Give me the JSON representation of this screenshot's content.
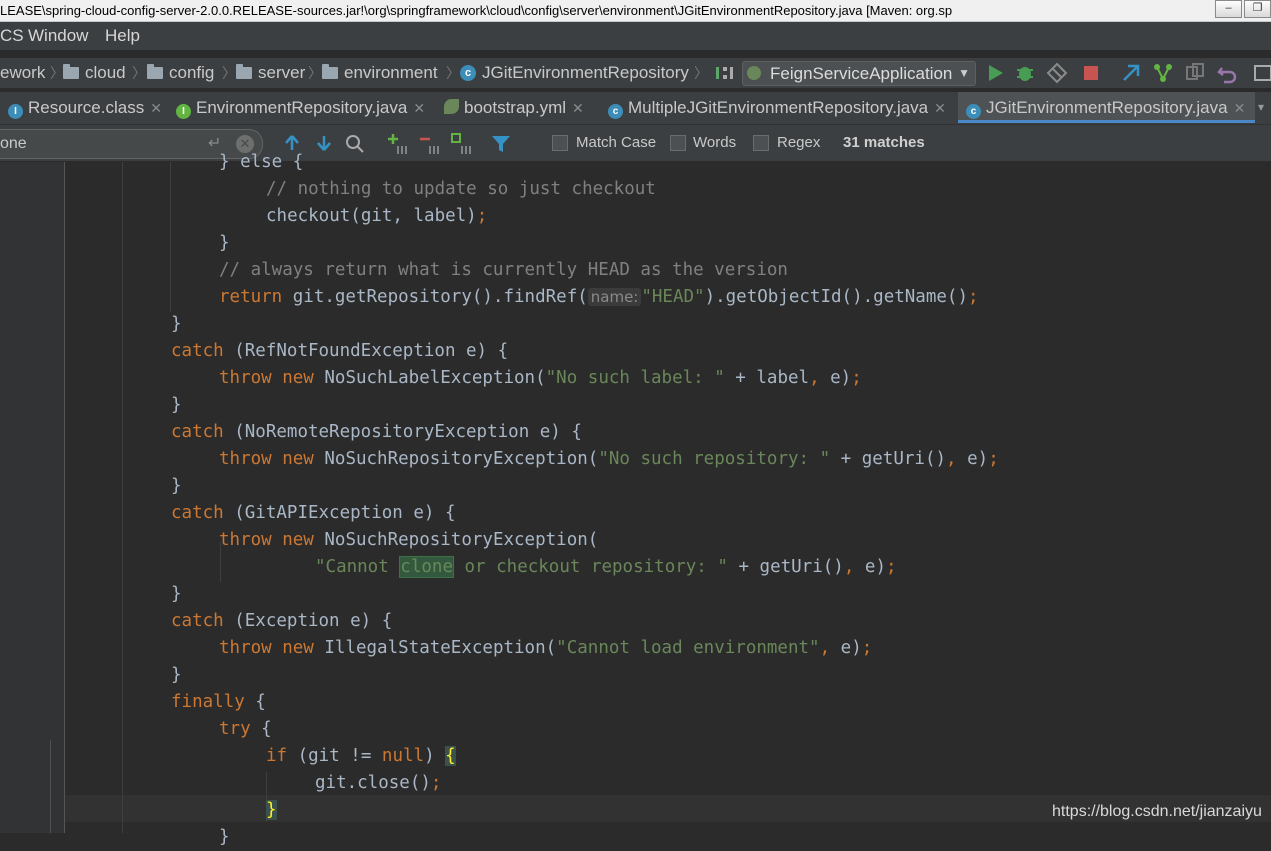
{
  "titlebar": {
    "title": "LEASE\\spring-cloud-config-server-2.0.0.RELEASE-sources.jar!\\org\\springframework\\cloud\\config\\server\\environment\\JGitEnvironmentRepository.java [Maven: org.sp"
  },
  "menu": {
    "vcs": "CS",
    "window": "Window",
    "help": "Help"
  },
  "breadcrumbs": [
    "ework",
    "cloud",
    "config",
    "server",
    "environment",
    "JGitEnvironmentRepository"
  ],
  "run_config": {
    "name": "FeignServiceApplication"
  },
  "tabs": [
    {
      "label": "Resource.class",
      "icon": "class-icon"
    },
    {
      "label": "EnvironmentRepository.java",
      "icon": "interface-icon"
    },
    {
      "label": "bootstrap.yml",
      "icon": "spring-leaf-icon"
    },
    {
      "label": "MultipleJGitEnvironmentRepository.java",
      "icon": "class-icon"
    },
    {
      "label": "JGitEnvironmentRepository.java",
      "icon": "class-icon",
      "active": true
    }
  ],
  "find": {
    "query": "one",
    "match_case": "Match Case",
    "words": "Words",
    "regex": "Regex",
    "matches": "31 matches"
  },
  "code": {
    "l0": "} else {",
    "l1": "// nothing to update so just checkout",
    "l2a": "checkout(git, label)",
    "l4": "// always return what is currently HEAD as the version",
    "l5a": "return",
    "l5b": " git.getRepository().findRef(",
    "l5hint": "name:",
    "l5str": "\"HEAD\"",
    "l5c": ").getObjectId().getName()",
    "catch": "catch",
    "throw": "throw",
    "new": "new",
    "l7": " (RefNotFoundException e) {",
    "l8a": " NoSuchLabelException(",
    "l8str": "\"No such label: \"",
    "l8b": " + label",
    "l8c": " e)",
    "l10": " (NoRemoteRepositoryException e) {",
    "l11a": " NoSuchRepositoryException(",
    "l11str": "\"No such repository: \"",
    "l11b": " + getUri()",
    "l11c": " e)",
    "l13": " (GitAPIException e) {",
    "l14a": " NoSuchRepositoryException(",
    "l15s1": "\"Cannot ",
    "l15match": "clone",
    "l15s2": " or checkout repository: \"",
    "l15b": " + getUri()",
    "l15c": " e)",
    "l17": " (Exception e) {",
    "l18a": " IllegalStateException(",
    "l18str": "\"Cannot load environment\"",
    "l18c": " e)",
    "finally": "finally",
    "try": "try",
    "if": "if",
    "l22a": " (git != ",
    "null": "null",
    "l22b": ") ",
    "l23": "git.close()"
  },
  "watermark": "https://blog.csdn.net/jianzaiyu"
}
